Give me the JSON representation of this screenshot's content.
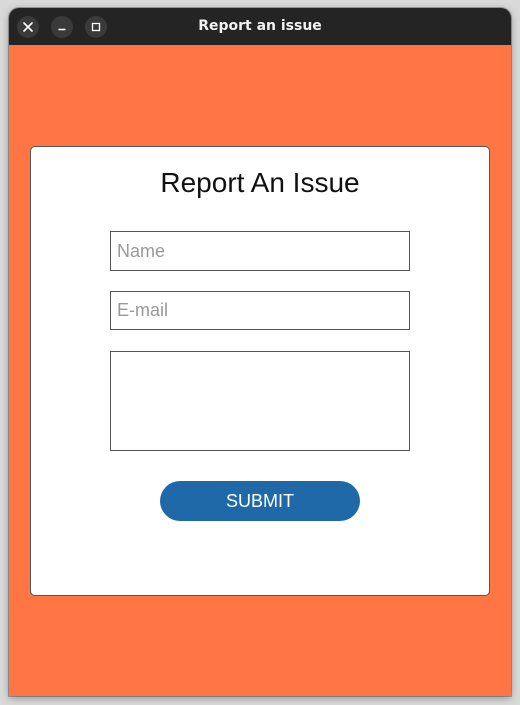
{
  "window": {
    "title": "Report an issue",
    "controls": {
      "close_icon": "close-icon",
      "minimize_icon": "minimize-icon",
      "maximize_icon": "maximize-icon"
    }
  },
  "colors": {
    "background": "#ff7544",
    "card": "#ffffff",
    "button": "#1f69a8",
    "titlebar": "#242424"
  },
  "form": {
    "heading": "Report An Issue",
    "name": {
      "value": "",
      "placeholder": "Name"
    },
    "email": {
      "value": "",
      "placeholder": "E-mail"
    },
    "message": {
      "value": "",
      "placeholder": ""
    },
    "submit_label": "SUBMIT"
  }
}
